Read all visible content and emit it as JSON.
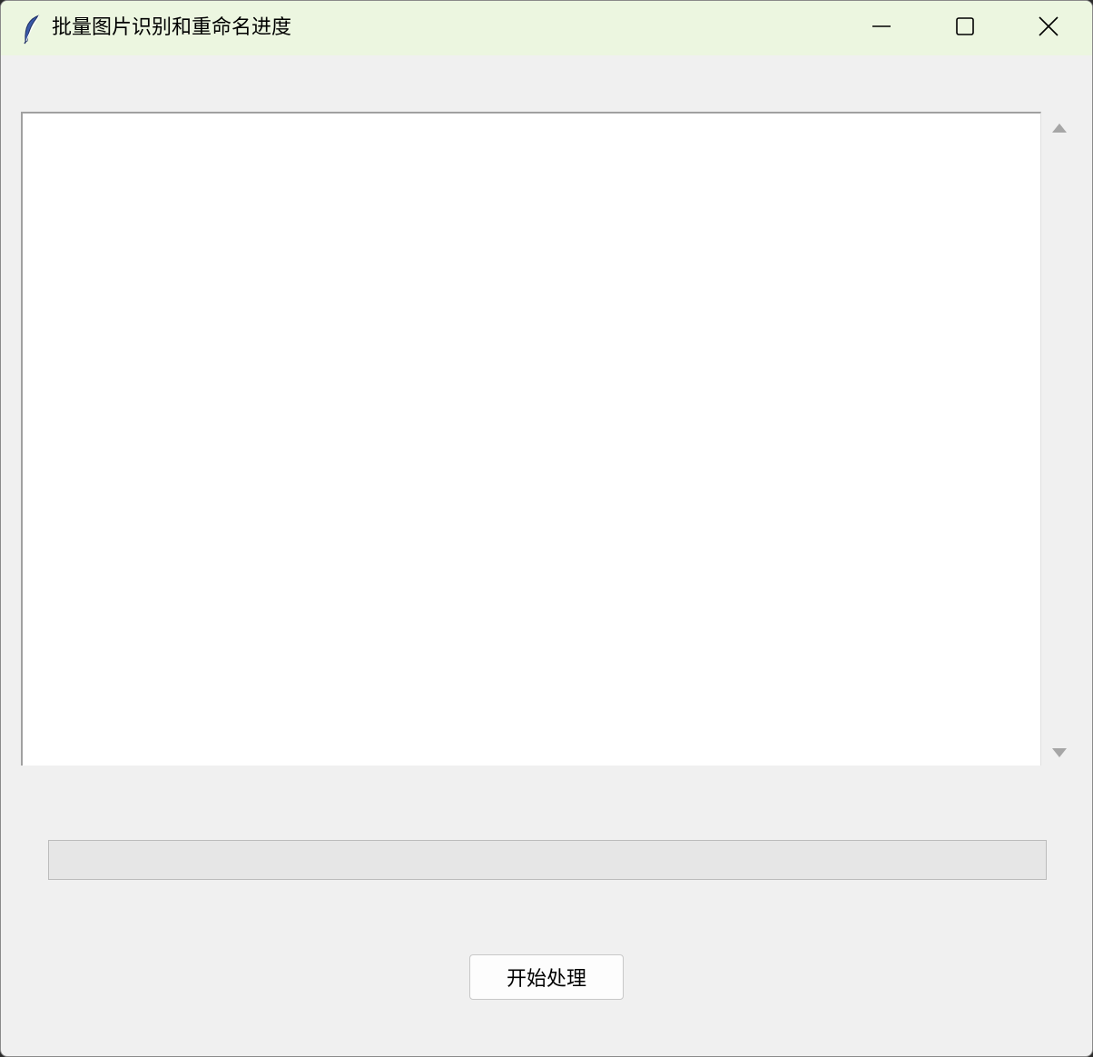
{
  "window": {
    "title": "批量图片识别和重命名进度",
    "app_icon": "feather-icon",
    "controls": [
      "minimize-icon",
      "maximize-icon",
      "close-icon"
    ]
  },
  "log": {
    "content": ""
  },
  "progress": {
    "value_percent": 0
  },
  "actions": {
    "start_label": "开始处理"
  },
  "colors": {
    "titlebar": "#ecf6e0",
    "window_bg": "#f0f0f0",
    "progress_fill": "#06b025"
  }
}
